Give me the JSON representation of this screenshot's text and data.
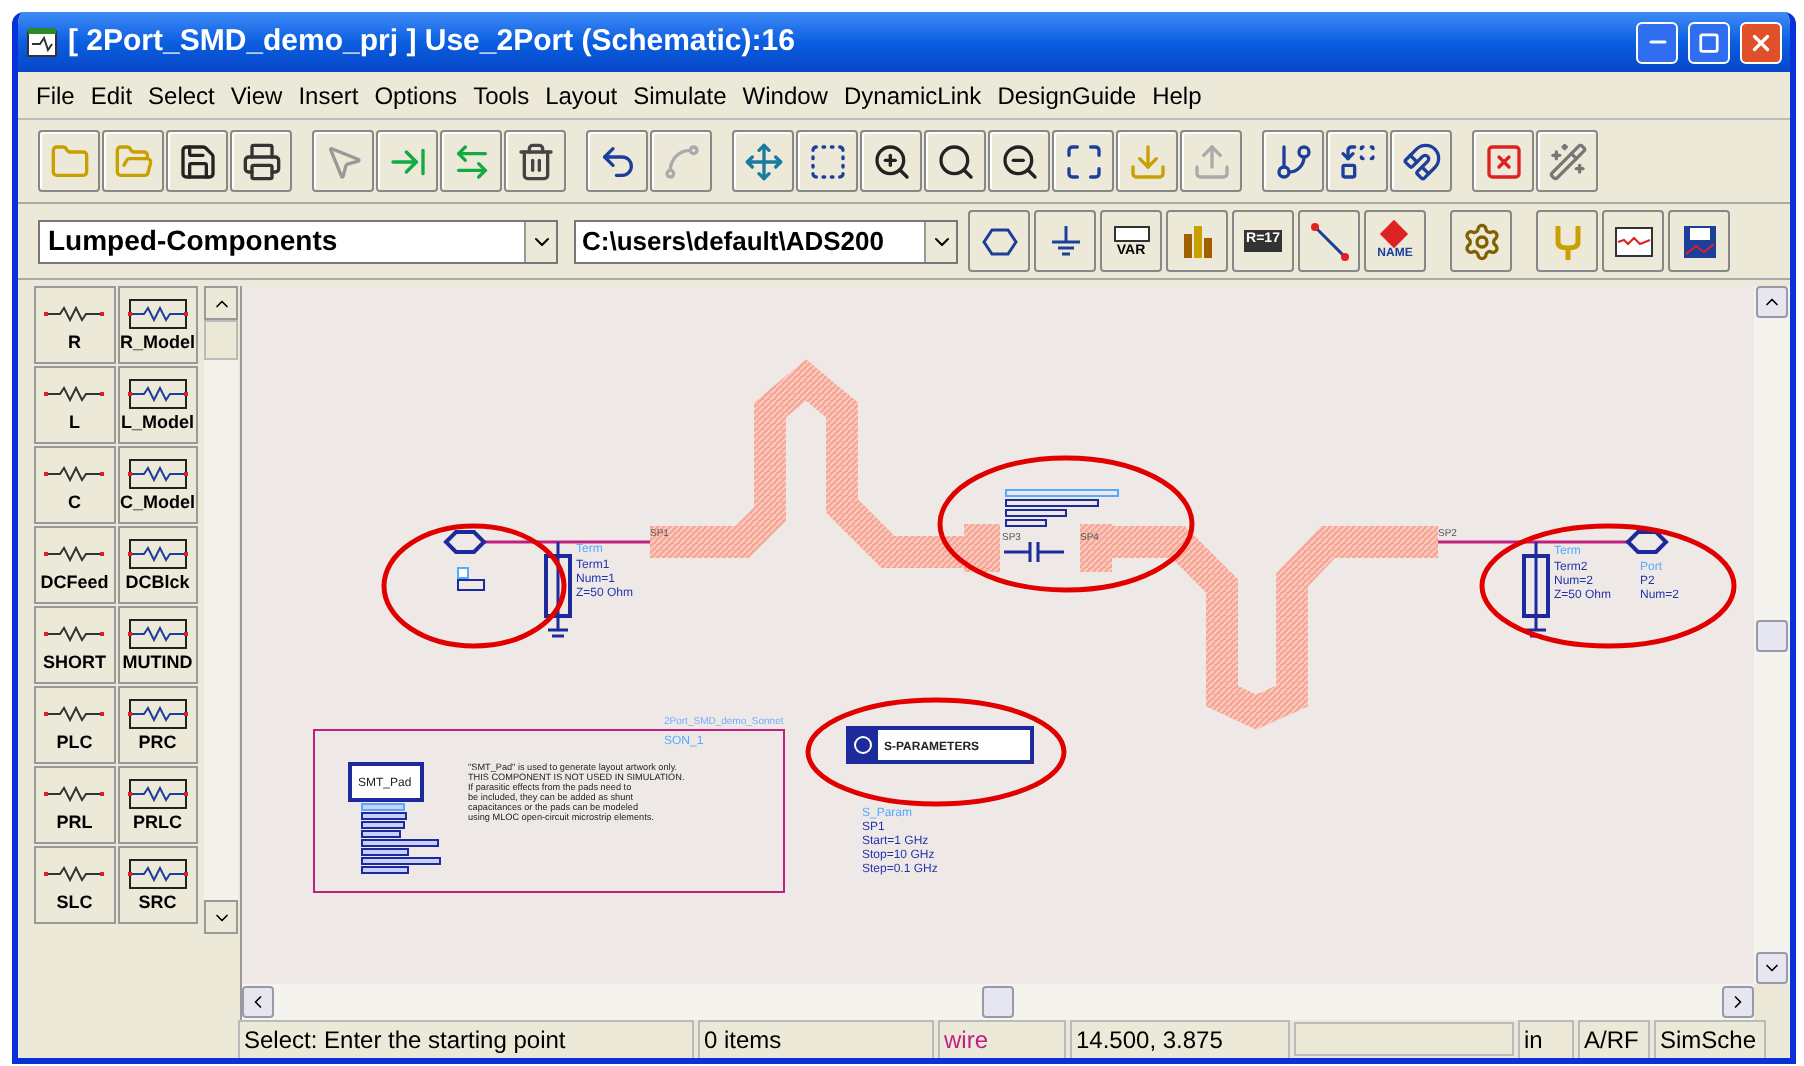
{
  "window": {
    "title": "[ 2Port_SMD_demo_prj ] Use_2Port (Schematic):16"
  },
  "menu": [
    "File",
    "Edit",
    "Select",
    "View",
    "Insert",
    "Options",
    "Tools",
    "Layout",
    "Simulate",
    "Window",
    "DynamicLink",
    "DesignGuide",
    "Help"
  ],
  "library_select": {
    "value": "Lumped-Components"
  },
  "path_select": {
    "value": "C:\\users\\default\\ADS200"
  },
  "component_buttons": [
    {
      "kind": "port"
    },
    {
      "kind": "ground"
    },
    {
      "kind": "var",
      "caption": "VAR"
    },
    {
      "kind": "bars"
    },
    {
      "kind": "eqn",
      "caption": "R=17"
    },
    {
      "kind": "wire"
    },
    {
      "kind": "name",
      "caption": "NAME"
    },
    {
      "kind": "gear"
    },
    {
      "kind": "probe"
    },
    {
      "kind": "plot"
    },
    {
      "kind": "save"
    }
  ],
  "palette": [
    {
      "label": "R"
    },
    {
      "label": "R_Model"
    },
    {
      "label": "L"
    },
    {
      "label": "L_Model"
    },
    {
      "label": "C"
    },
    {
      "label": "C_Model"
    },
    {
      "label": "DCFeed"
    },
    {
      "label": "DCBlck"
    },
    {
      "label": "SHORT"
    },
    {
      "label": "MUTIND"
    },
    {
      "label": "PLC"
    },
    {
      "label": "PRC"
    },
    {
      "label": "PRL"
    },
    {
      "label": "PRLC"
    },
    {
      "label": "SLC"
    },
    {
      "label": "SRC"
    }
  ],
  "canvas": {
    "term1": {
      "label": "Term",
      "name": "Term1",
      "num": "Num=1",
      "z": "Z=50 Ohm"
    },
    "trace_labels": [
      "SP1",
      "SP3",
      "SP4",
      "SP2"
    ],
    "term2": {
      "label": "Term",
      "name": "Term2",
      "num": "Num=2",
      "z": "Z=50 Ohm"
    },
    "port": {
      "label": "Port",
      "name": "P2",
      "num": "Num=2"
    },
    "smt_pad": {
      "symbol": "SMT_Pad",
      "note": [
        "\"SMT_Pad\" is used to generate layout artwork only.",
        "THIS COMPONENT IS NOT USED IN SIMULATION.",
        "If parasitic effects from the pads need to",
        "be included, they can be added as shunt",
        "capacitances or the pads can be modeled",
        "using MLOC open-circuit microstrip elements."
      ]
    },
    "sonnet": {
      "file": "2Port_SMD_demo_Sonnet",
      "name": "SON_1"
    },
    "sparam": {
      "title": "S-PARAMETERS",
      "label": "S_Param",
      "name": "SP1",
      "params": [
        "Start=1 GHz",
        "Stop=10 GHz",
        "Step=0.1 GHz"
      ]
    }
  },
  "status_bar": {
    "message": "Select: Enter the starting point",
    "count": "0 items",
    "mode": "wire",
    "coordinates": "14.500, 3.875",
    "units": "in",
    "domain": "A/RF",
    "window": "SimSche"
  }
}
